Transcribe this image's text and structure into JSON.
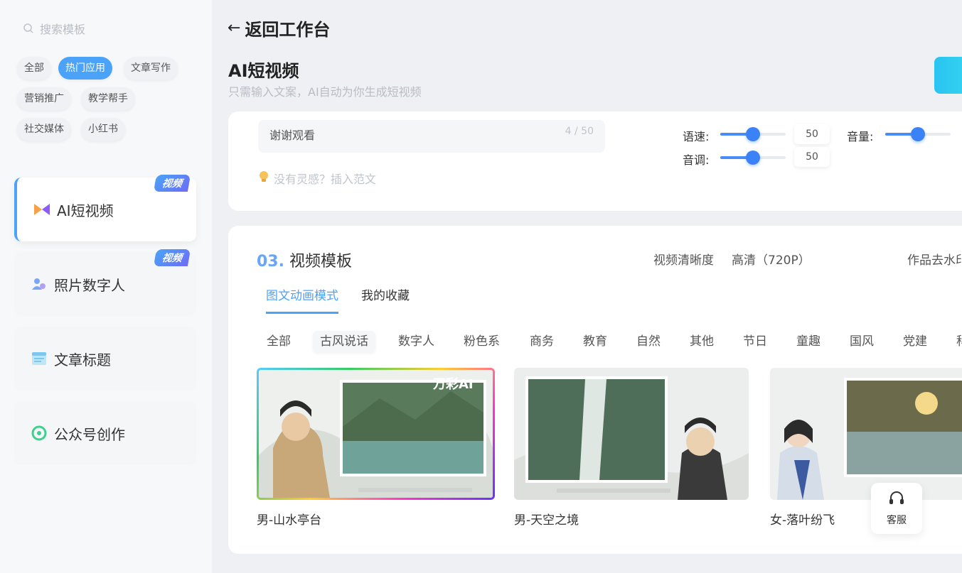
{
  "sidebar": {
    "search_placeholder": "搜索模板",
    "chips": [
      {
        "label": "全部"
      },
      {
        "label": "热门应用"
      },
      {
        "label": "文章写作"
      },
      {
        "label": "营销推广"
      },
      {
        "label": "教学帮手"
      },
      {
        "label": "社交媒体"
      },
      {
        "label": "小红书"
      }
    ],
    "nav": [
      {
        "label": "AI短视频",
        "badge": "视频"
      },
      {
        "label": "照片数字人",
        "badge": "视频"
      },
      {
        "label": "文章标题"
      },
      {
        "label": "公众号创作"
      }
    ]
  },
  "header": {
    "back_label": "返回工作台",
    "title": "AI短视频",
    "subtitle": "只需输入文案，AI自动为你生成短视频"
  },
  "script_input": {
    "value": "谢谢观看",
    "counter": "4 / 50",
    "hint": "没有灵感？插入范文"
  },
  "sliders": {
    "speed": {
      "label": "语速:",
      "value": "50",
      "level": 50
    },
    "volume": {
      "label": "音量:",
      "level": 50
    },
    "pitch": {
      "label": "音调:",
      "value": "50",
      "level": 50
    }
  },
  "templates": {
    "number": "03.",
    "title": "视频模板",
    "quality_label": "视频清晰度",
    "quality_value": "高清（720P）",
    "watermark_label": "作品去水印",
    "tabs": [
      {
        "label": "图文动画模式"
      },
      {
        "label": "我的收藏"
      }
    ],
    "categories": [
      "全部",
      "古风说话",
      "数字人",
      "粉色系",
      "商务",
      "教育",
      "自然",
      "其他",
      "节日",
      "童趣",
      "国风",
      "党建",
      "科"
    ],
    "items": [
      {
        "label": "男-山水亭台",
        "overlay": "万彩AI"
      },
      {
        "label": "男-天空之境"
      },
      {
        "label": "女-落叶纷飞"
      }
    ]
  },
  "service": {
    "label": "客服"
  },
  "colors": {
    "accent": "#4aa3f8",
    "slider": "#3b82f6",
    "section_number": "#6aa6f7"
  }
}
